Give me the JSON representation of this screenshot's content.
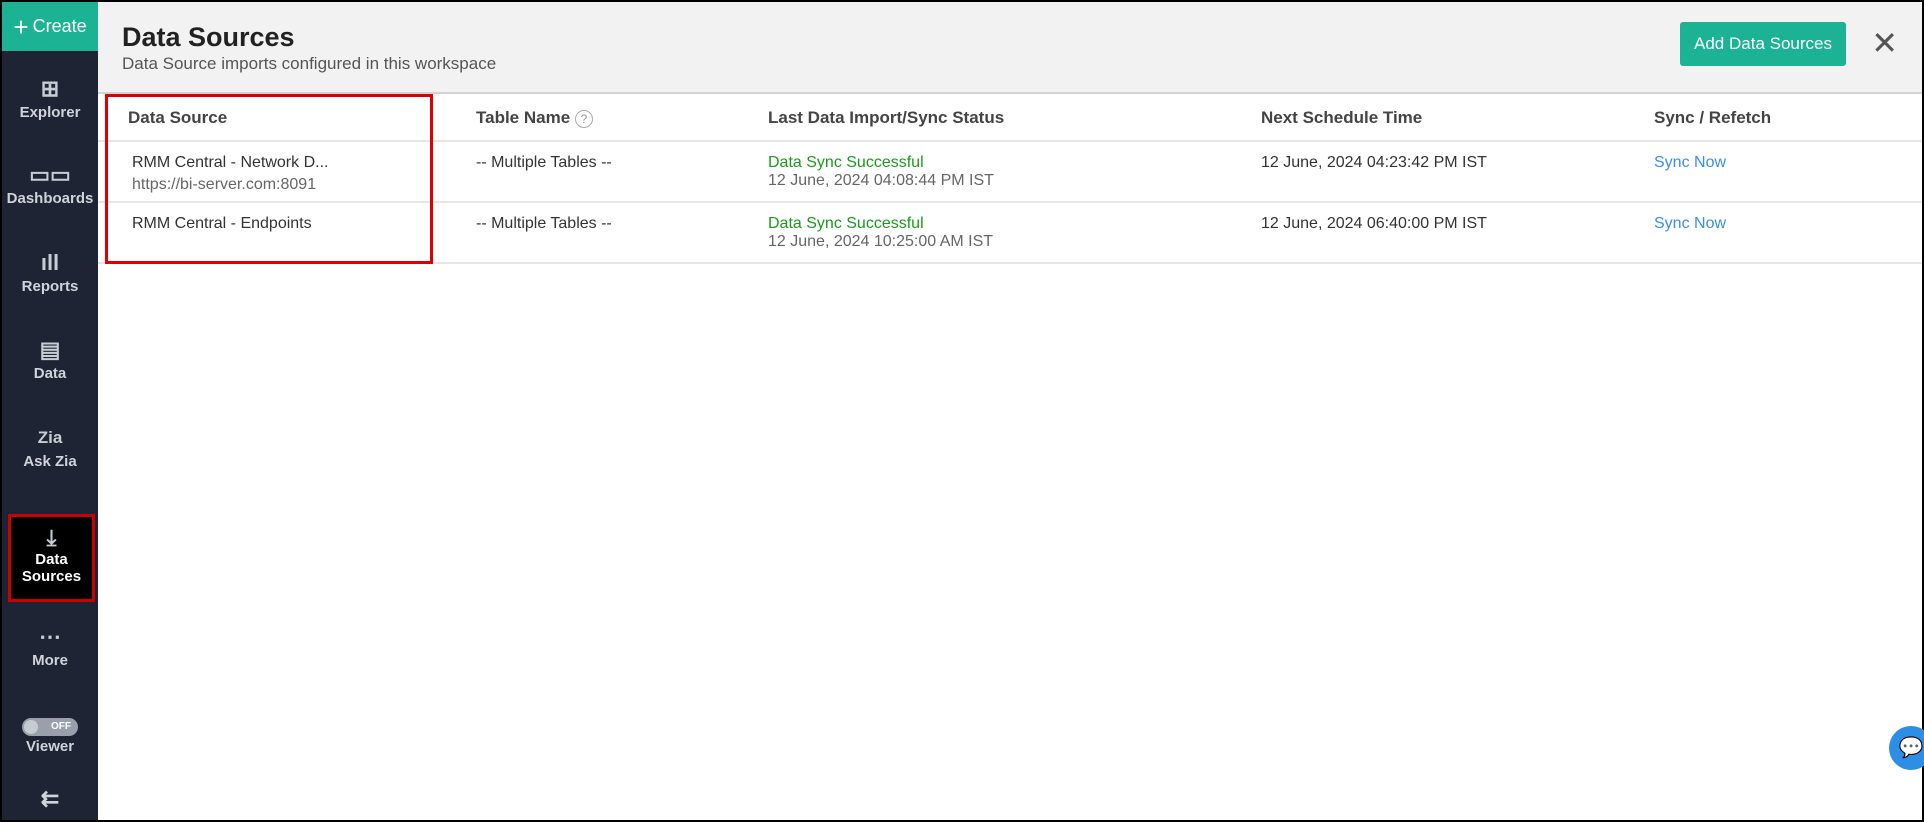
{
  "sidebar": {
    "create_label": "Create",
    "items": [
      {
        "label": "Explorer",
        "icon": "explorer-icon"
      },
      {
        "label": "Dashboards",
        "icon": "dashboards-icon"
      },
      {
        "label": "Reports",
        "icon": "reports-icon"
      },
      {
        "label": "Data",
        "icon": "data-icon"
      },
      {
        "label": "Ask Zia",
        "icon": "ask-zia-icon"
      },
      {
        "label1": "Data",
        "label2": "Sources",
        "icon": "data-sources-icon"
      },
      {
        "label": "More",
        "icon": "more-icon"
      }
    ],
    "viewer_label": "Viewer",
    "viewer_toggle": "OFF"
  },
  "header": {
    "title": "Data Sources",
    "subtitle": "Data Source imports configured in this workspace",
    "add_button": "Add Data Sources"
  },
  "table": {
    "columns": [
      "Data Source",
      "Table Name",
      "Last Data Import/Sync Status",
      "Next Schedule Time",
      "Sync / Refetch"
    ],
    "rows": [
      {
        "name": "RMM Central - Network D...",
        "url": "https://bi-server.com:8091",
        "table": "-- Multiple Tables --",
        "status": "Data Sync Successful",
        "last_time": "12 June, 2024 04:08:44 PM IST",
        "next": "12 June, 2024 04:23:42 PM IST",
        "action": "Sync Now"
      },
      {
        "name": "RMM Central - Endpoints",
        "table": "-- Multiple Tables --",
        "status": "Data Sync Successful",
        "last_time": "12 June, 2024 10:25:00 AM IST",
        "next": "12 June, 2024 06:40:00 PM IST",
        "action": "Sync Now"
      }
    ]
  },
  "colors": {
    "accent": "#1cb394",
    "sidebar": "#1e2433",
    "success": "#1a9a1a",
    "link": "#3a8ee6"
  }
}
